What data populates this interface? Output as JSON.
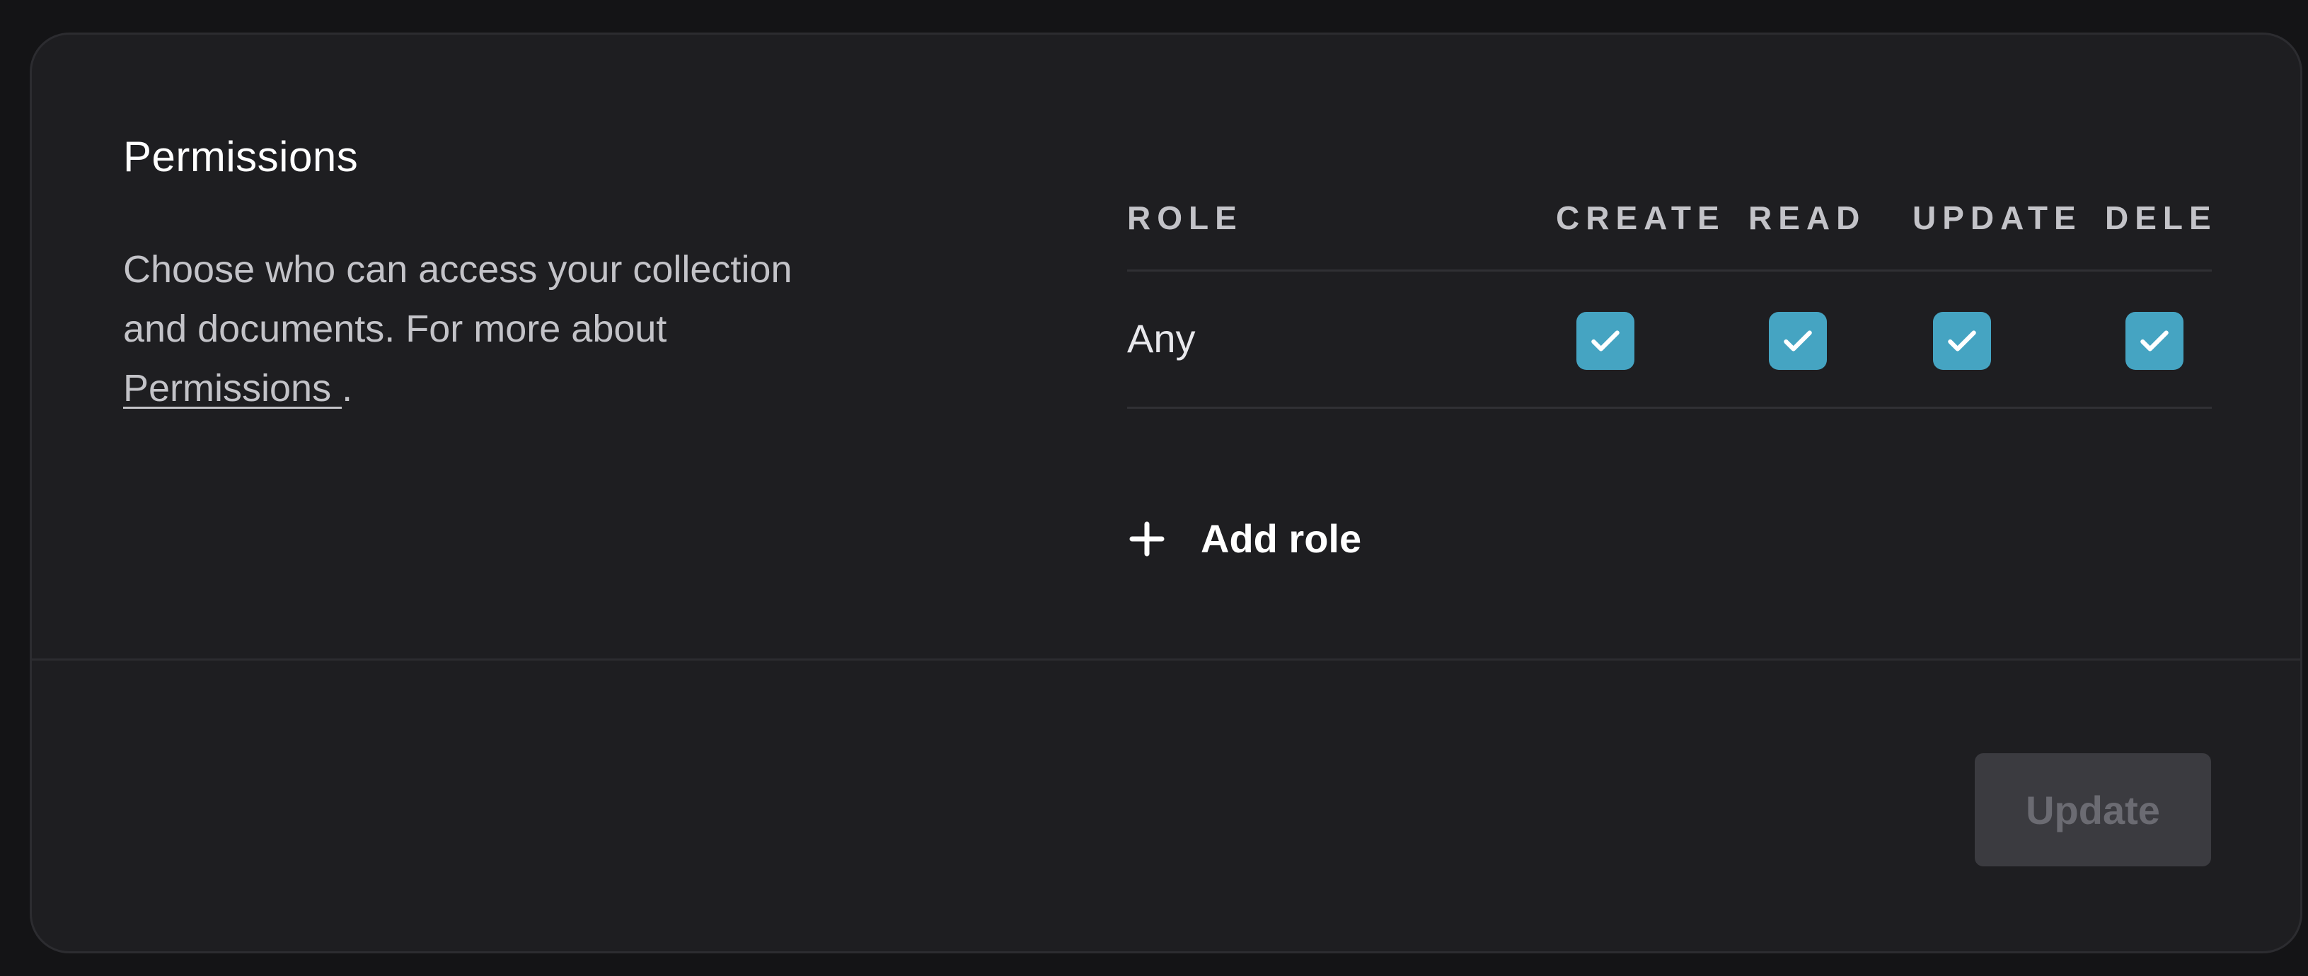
{
  "section": {
    "title": "Permissions",
    "description_text": "Choose who can access your collection and documents. For more about ",
    "description_link": "Permissions ",
    "description_end": "."
  },
  "table": {
    "headers": {
      "role": "ROLE",
      "create": "CREATE",
      "read": "READ",
      "update": "UPDATE",
      "delete": "DELETE"
    },
    "rows": [
      {
        "role": "Any",
        "create": true,
        "read": true,
        "update": true,
        "delete": true
      }
    ]
  },
  "actions": {
    "add_role_label": "Add role",
    "update_label": "Update",
    "update_disabled": true
  },
  "colors": {
    "accent": "#45a4c2",
    "card_background": "#1e1e21",
    "page_background": "#141416"
  },
  "icons": {
    "check": "check-icon",
    "plus": "plus-icon"
  }
}
